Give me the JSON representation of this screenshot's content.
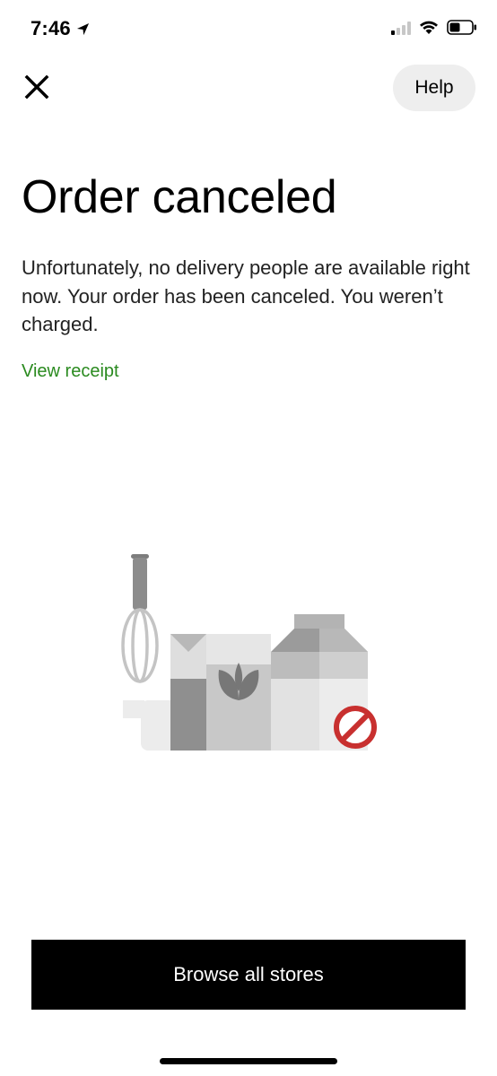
{
  "status_bar": {
    "time": "7:46",
    "icons": [
      "location-arrow-icon",
      "cellular-signal-icon",
      "wifi-icon",
      "battery-icon"
    ]
  },
  "header": {
    "close_icon": "close-icon",
    "help_label": "Help"
  },
  "main": {
    "title": "Order canceled",
    "message": "Unfortunately, no delivery people are available right now. Your order has been canceled. You weren’t charged.",
    "view_receipt_label": "View receipt",
    "illustration": "grocery-canceled-illustration"
  },
  "footer": {
    "browse_label": "Browse all stores"
  },
  "colors": {
    "accent_link": "#2a8a1f",
    "primary_button_bg": "#000000",
    "help_button_bg": "#eeeeee",
    "prohibited_red": "#c8302f"
  }
}
